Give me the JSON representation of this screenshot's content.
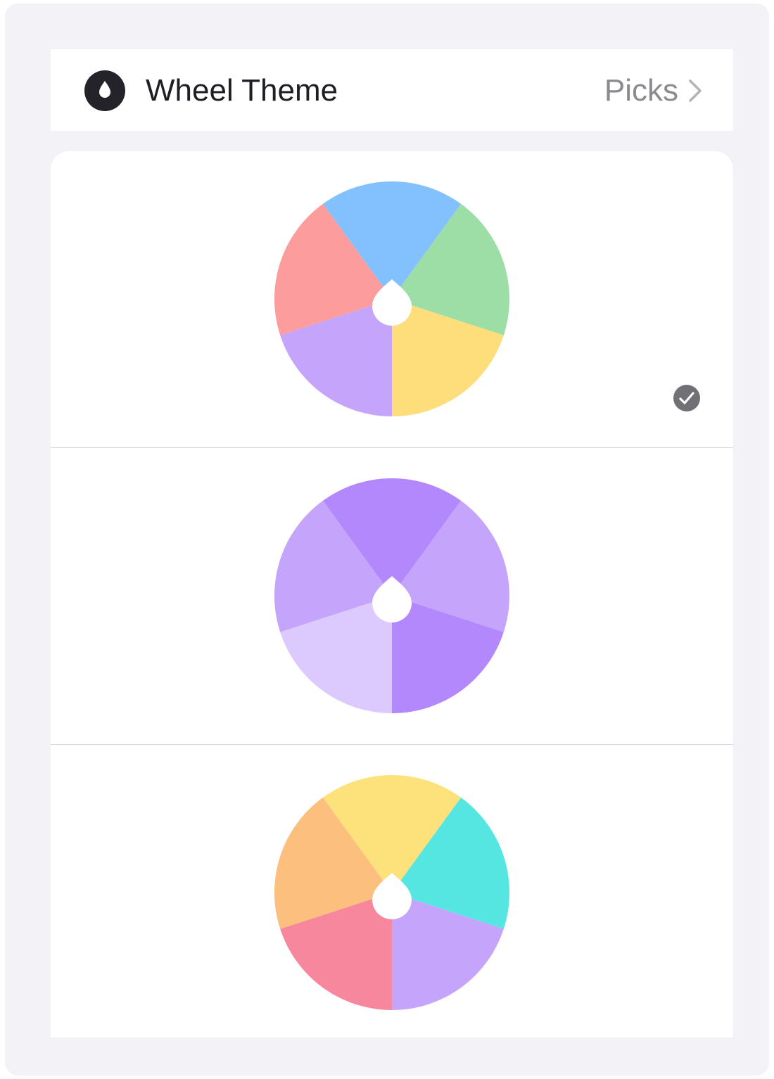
{
  "header": {
    "title": "Wheel Theme",
    "link_label": "Picks",
    "icon": "drop-icon",
    "link_icon": "chevron-right-icon"
  },
  "themes": [
    {
      "selected": true,
      "colors": [
        "#82c1fd",
        "#9ddda6",
        "#fedd7b",
        "#c5a5fb",
        "#fd9c9c"
      ]
    },
    {
      "selected": false,
      "colors": [
        "#b488fd",
        "#c5a5fb",
        "#b488fd",
        "#dcc9fd",
        "#c5a5fb"
      ]
    },
    {
      "selected": false,
      "colors": [
        "#fde17b",
        "#55e6e2",
        "#c5a5fb",
        "#f6879d",
        "#fdbf7d"
      ]
    }
  ],
  "selected_icon": "checkmark-circle-icon",
  "center_icon": "drop-icon"
}
